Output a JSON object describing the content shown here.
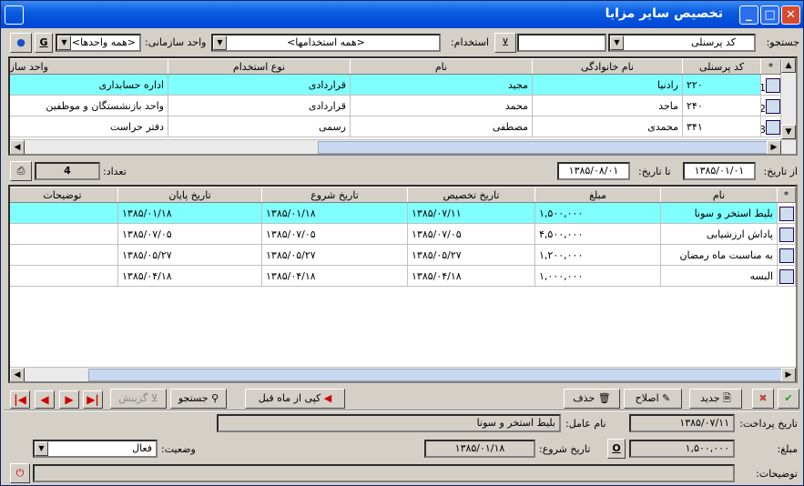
{
  "window": {
    "title": "تخصیص سایر مزایا"
  },
  "filter": {
    "search_label": "جستجو:",
    "search_field_value": "کد پرسنلی",
    "search_text": "",
    "employment_label": "استخدام:",
    "employment_value": "<همه استخدامها>",
    "unit_label": "واحد سازمانی:",
    "unit_value": "<همه واحدها>",
    "g_button": "G"
  },
  "employees": {
    "columns": [
      "*",
      "کد پرسنلی",
      "نام خانوادگی",
      "نام",
      "نوع استخدام",
      "واحد سازمانی"
    ],
    "rows": [
      {
        "num": "1",
        "code": "۲۲۰",
        "family": "رادنیا",
        "name": "مجید",
        "type": "قراردادی",
        "unit": "اداره حسابداری"
      },
      {
        "num": "2",
        "code": "۲۴۰",
        "family": "ماجد",
        "name": "محمد",
        "type": "قراردادی",
        "unit": "واحد بازنشستگان و موظفین"
      },
      {
        "num": "3",
        "code": "۳۴۱",
        "family": "محمدی",
        "name": "مصطفی",
        "type": "رسمی",
        "unit": "دفتر حراست"
      }
    ]
  },
  "range": {
    "from_label": "از تاریخ:",
    "from_value": "۱۳۸۵/۰۱/۰۱",
    "to_label": "تا تاریخ:",
    "to_value": "۱۳۸۵/۰۸/۰۱",
    "count_label": "تعداد:",
    "count_value": "4"
  },
  "benefits": {
    "columns": [
      "*",
      "نام",
      "مبلغ",
      "تاریخ تخصیص",
      "تاریخ شروع",
      "تاریخ پایان",
      "توضیحات"
    ],
    "rows": [
      {
        "name": "بلیط استخر و سونا",
        "amount": "۱,۵۰۰,۰۰۰",
        "alloc": "۱۳۸۵/۰۷/۱۱",
        "start": "۱۳۸۵/۰۱/۱۸",
        "end": "۱۳۸۵/۰۱/۱۸",
        "desc": ""
      },
      {
        "name": "پاداش ارزشیابی",
        "amount": "۴,۵۰۰,۰۰۰",
        "alloc": "۱۳۸۵/۰۷/۰۵",
        "start": "۱۳۸۵/۰۷/۰۵",
        "end": "۱۳۸۵/۰۷/۰۵",
        "desc": ""
      },
      {
        "name": "به مناسبت ماه رمضان",
        "amount": "۱,۲۰۰,۰۰۰",
        "alloc": "۱۳۸۵/۰۵/۲۷",
        "start": "۱۳۸۵/۰۵/۲۷",
        "end": "۱۳۸۵/۰۵/۲۷",
        "desc": ""
      },
      {
        "name": "البسه",
        "amount": "۱,۰۰۰,۰۰۰",
        "alloc": "۱۳۸۵/۰۴/۱۸",
        "start": "۱۳۸۵/۰۴/۱۸",
        "end": "۱۳۸۵/۰۴/۱۸",
        "desc": ""
      }
    ]
  },
  "toolbar": {
    "new": "جدید",
    "edit": "اصلاح",
    "delete": "حذف",
    "copy": "کپی از ماه قبل",
    "search": "جستجو",
    "filter": "گزینش"
  },
  "details": {
    "pay_date_label": "تاریخ پرداخت:",
    "pay_date_value": "۱۳۸۵/۰۷/۱۱",
    "factor_label": "نام عامل:",
    "factor_value": "بلیط استخر و سونا",
    "amount_label": "مبلغ:",
    "amount_value": "۱,۵۰۰,۰۰۰",
    "o_button": "O",
    "start_label": "تاریخ شروع:",
    "start_value": "۱۳۸۵/۰۱/۱۸",
    "status_label": "وضعیت:",
    "status_value": "فعال",
    "notes_label": "توضیحات:",
    "notes_value": ""
  },
  "colors": {
    "selected_row": "#80ffff",
    "titlebar": "#0b5ce0"
  }
}
